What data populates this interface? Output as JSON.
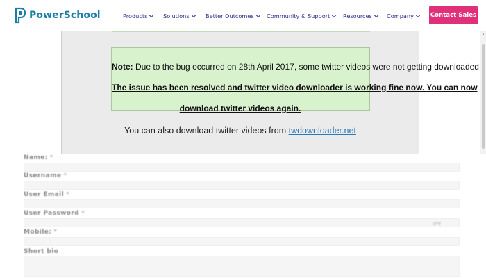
{
  "header": {
    "brand": "PowerSchool",
    "nav": [
      {
        "label": "Products"
      },
      {
        "label": "Solutions"
      },
      {
        "label": "Better Outcomes"
      },
      {
        "label": "Community & Support"
      },
      {
        "label": "Resources"
      },
      {
        "label": "Company"
      }
    ],
    "cta_label": "Contact Sales"
  },
  "notice": {
    "note_prefix": "Note:",
    "note_text": " Due to the bug occurred on 28th April 2017, some twitter videos were not getting downloaded.",
    "resolved_line1": "The issue has been resolved and twitter video downloader is working fine now. You can now",
    "resolved_line2": "download twitter videos again.",
    "also_text": "You can also download twitter videos from ",
    "also_link": "twdownloader.net"
  },
  "form": {
    "fields": [
      {
        "label": "Name:",
        "required_mark": "*"
      },
      {
        "label": "Username",
        "required_mark": "*"
      },
      {
        "label": "User Email",
        "required_mark": "*"
      },
      {
        "label": "User Password",
        "required_mark": "*"
      },
      {
        "label": "Mobile:",
        "required_mark": "*"
      },
      {
        "label": "Short bio",
        "required_mark": ""
      }
    ],
    "side_note": "(20)"
  },
  "colors": {
    "brand": "#1a7fa6",
    "nav_text": "#2b2b8a",
    "cta": "#e1307a",
    "note_bg": "#d8f2cd"
  }
}
